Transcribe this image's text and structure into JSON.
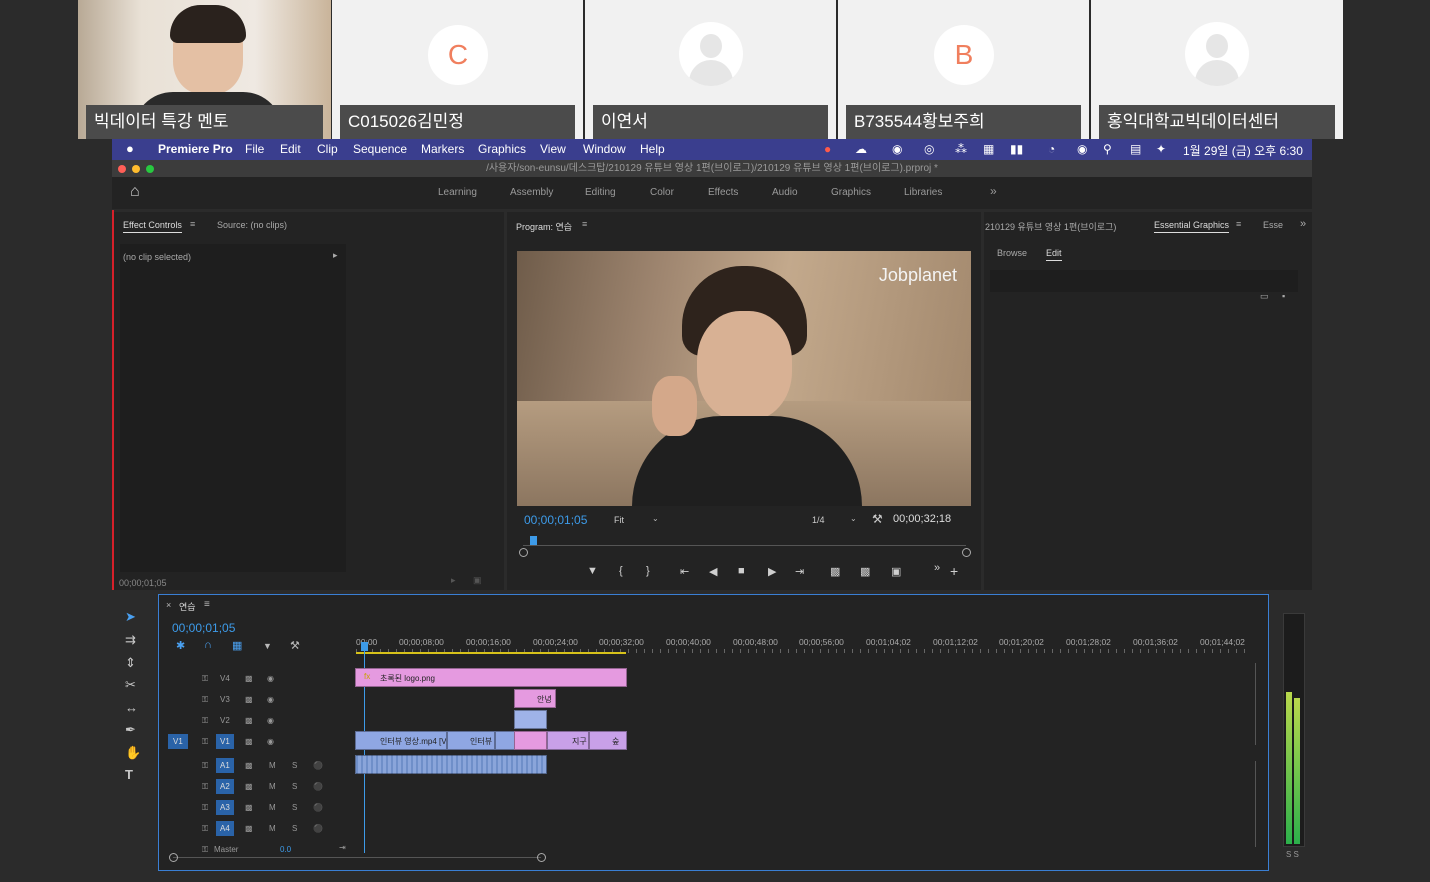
{
  "conference": {
    "tiles": [
      {
        "name": "빅데이터 특강 멘토",
        "type": "video"
      },
      {
        "name": "C015026김민정",
        "type": "letter",
        "letter": "C"
      },
      {
        "name": "이연서",
        "type": "person"
      },
      {
        "name": "B735544황보주희",
        "type": "letter",
        "letter": "B"
      },
      {
        "name": "홍익대학교빅데이터센터",
        "type": "person"
      }
    ]
  },
  "menubar": {
    "app_name": "Premiere Pro",
    "items": [
      "File",
      "Edit",
      "Clip",
      "Sequence",
      "Markers",
      "Graphics",
      "View",
      "Window",
      "Help"
    ],
    "clock": "1월 29일 (금) 오후 6:30"
  },
  "window": {
    "title_path": "/사용자/son-eunsu/데스크탑/210129 유튜브 영상 1편(브이로그)/210129 유튜브 영상 1편(브이로그).prproj *"
  },
  "workspaces": [
    "Learning",
    "Assembly",
    "Editing",
    "Color",
    "Effects",
    "Audio",
    "Graphics",
    "Libraries"
  ],
  "effect_controls": {
    "tab1": "Effect Controls",
    "tab2": "Source: (no clips)",
    "no_clip": "(no clip selected)",
    "timecode": "00;00;01;05"
  },
  "program_monitor": {
    "title": "Program: 연습",
    "watermark": "Jobplanet",
    "timecode": "00;00;01;05",
    "fit": "Fit",
    "resolution": "1/4",
    "duration": "00;00;32;18"
  },
  "essential_graphics": {
    "project_tab": "210129 유튜브 영상 1편(브이로그)",
    "tab": "Essential Graphics",
    "tab_short": "Esse",
    "browse": "Browse",
    "edit": "Edit"
  },
  "timeline": {
    "sequence_name": "연습",
    "timecode": "00;00;01;05",
    "ruler": [
      "00;00",
      "00;00;08;00",
      "00;00;16;00",
      "00;00;24;00",
      "00;00;32;00",
      "00;00;40;00",
      "00;00;48;00",
      "00;00;56;00",
      "00;01;04;02",
      "00;01;12;02",
      "00;01;20;02",
      "00;01;28;02",
      "00;01;36;02",
      "00;01;44;02"
    ],
    "video_tracks": [
      "V4",
      "V3",
      "V2",
      "V1"
    ],
    "audio_tracks": [
      "A1",
      "A2",
      "A3",
      "A4"
    ],
    "source_patch": "V1",
    "master_label": "Master",
    "master_value": "0.0",
    "clips": {
      "v4_logo": "초록된 logo.png",
      "v3_title": "안녕",
      "v1_a": "인터뷰 영상.mp4 [V",
      "v1_b": "인터뷰",
      "v1_c": "지구",
      "v1_d": "숲"
    },
    "meter_label": "S S"
  }
}
